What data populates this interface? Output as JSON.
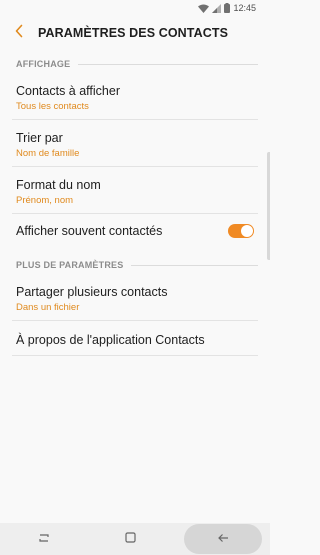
{
  "status_bar": {
    "time": "12:45",
    "icons": [
      "wifi-icon",
      "signal-icon",
      "battery-icon"
    ]
  },
  "header": {
    "title": "PARAMÈTRES DES CONTACTS",
    "back_icon": "chevron-left-icon"
  },
  "sections": {
    "display": "AFFICHAGE",
    "more": "PLUS DE PARAMÈTRES"
  },
  "settings": {
    "contacts_to_show": {
      "title": "Contacts à afficher",
      "value": "Tous les contacts"
    },
    "sort_by": {
      "title": "Trier par",
      "value": "Nom de famille"
    },
    "name_format": {
      "title": "Format du nom",
      "value": "Prénom, nom"
    },
    "frequent": {
      "title": "Afficher souvent contactés",
      "enabled": true
    },
    "share": {
      "title": "Partager plusieurs contacts",
      "value": "Dans un fichier"
    },
    "about": {
      "title": "À propos de l'application Contacts"
    }
  },
  "colors": {
    "accent": "#f08a24",
    "subtitle": "#e08a1e"
  },
  "nav_bar": {
    "icons": [
      "recent-apps-icon",
      "home-icon",
      "back-arrow-icon"
    ]
  }
}
